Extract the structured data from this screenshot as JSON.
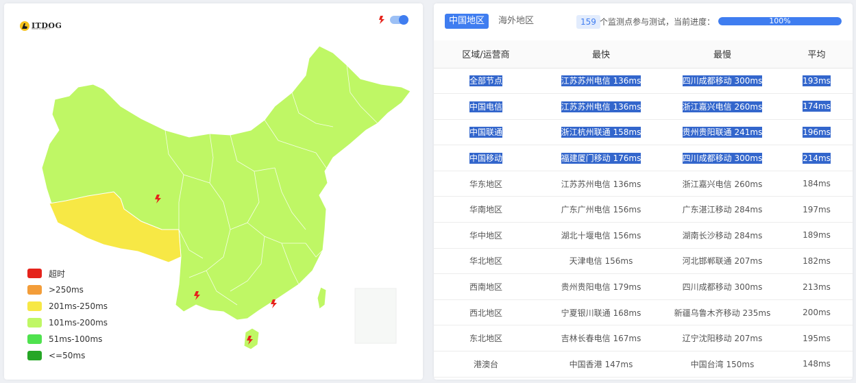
{
  "map": {
    "logo_text": "ITDOG",
    "logo_sub": "www.itdog.cn",
    "legend": [
      {
        "label": "超时",
        "color": "#e5231b"
      },
      {
        "label": ">250ms",
        "color": "#f39d39"
      },
      {
        "label": "201ms-250ms",
        "color": "#f7e845"
      },
      {
        "label": "101ms-200ms",
        "color": "#bff765"
      },
      {
        "label": "51ms-100ms",
        "color": "#4fe24e"
      },
      {
        "label": "<=50ms",
        "color": "#25a626"
      }
    ],
    "colors": {
      "main": "#bff765",
      "tibet": "#f7e845",
      "border": "#ffffff",
      "marker": "#e5231b",
      "toggle": "#3f7df0"
    }
  },
  "header": {
    "tab_china": "中国地区",
    "tab_overseas": "海外地区",
    "probe_count": "159",
    "probe_text": "个监测点参与测试，当前进度：",
    "progress_label": "100%",
    "progress_value": 100
  },
  "table": {
    "columns": [
      "区域/运营商",
      "最快",
      "最慢",
      "平均"
    ],
    "rows": [
      {
        "region": "全部节点",
        "fastest": "江苏苏州电信 136ms",
        "slowest": "四川成都移动 300ms",
        "avg": "193ms",
        "highlight": true
      },
      {
        "region": "中国电信",
        "fastest": "江苏苏州电信 136ms",
        "slowest": "浙江嘉兴电信 260ms",
        "avg": "174ms",
        "highlight": true
      },
      {
        "region": "中国联通",
        "fastest": "浙江杭州联通 158ms",
        "slowest": "贵州贵阳联通 241ms",
        "avg": "196ms",
        "highlight": true
      },
      {
        "region": "中国移动",
        "fastest": "福建厦门移动 176ms",
        "slowest": "四川成都移动 300ms",
        "avg": "214ms",
        "highlight": true
      },
      {
        "region": "华东地区",
        "fastest": "江苏苏州电信 136ms",
        "slowest": "浙江嘉兴电信 260ms",
        "avg": "184ms",
        "highlight": false
      },
      {
        "region": "华南地区",
        "fastest": "广东广州电信 156ms",
        "slowest": "广东湛江移动 284ms",
        "avg": "197ms",
        "highlight": false
      },
      {
        "region": "华中地区",
        "fastest": "湖北十堰电信 156ms",
        "slowest": "湖南长沙移动 284ms",
        "avg": "189ms",
        "highlight": false
      },
      {
        "region": "华北地区",
        "fastest": "天津电信 156ms",
        "slowest": "河北邯郸联通 207ms",
        "avg": "182ms",
        "highlight": false
      },
      {
        "region": "西南地区",
        "fastest": "贵州贵阳电信 179ms",
        "slowest": "四川成都移动 300ms",
        "avg": "213ms",
        "highlight": false
      },
      {
        "region": "西北地区",
        "fastest": "宁夏银川联通 168ms",
        "slowest": "新疆乌鲁木齐移动 235ms",
        "avg": "200ms",
        "highlight": false
      },
      {
        "region": "东北地区",
        "fastest": "吉林长春电信 167ms",
        "slowest": "辽宁沈阳移动 207ms",
        "avg": "195ms",
        "highlight": false
      },
      {
        "region": "港澳台",
        "fastest": "中国香港 147ms",
        "slowest": "中国台湾 150ms",
        "avg": "148ms",
        "highlight": false
      }
    ]
  }
}
